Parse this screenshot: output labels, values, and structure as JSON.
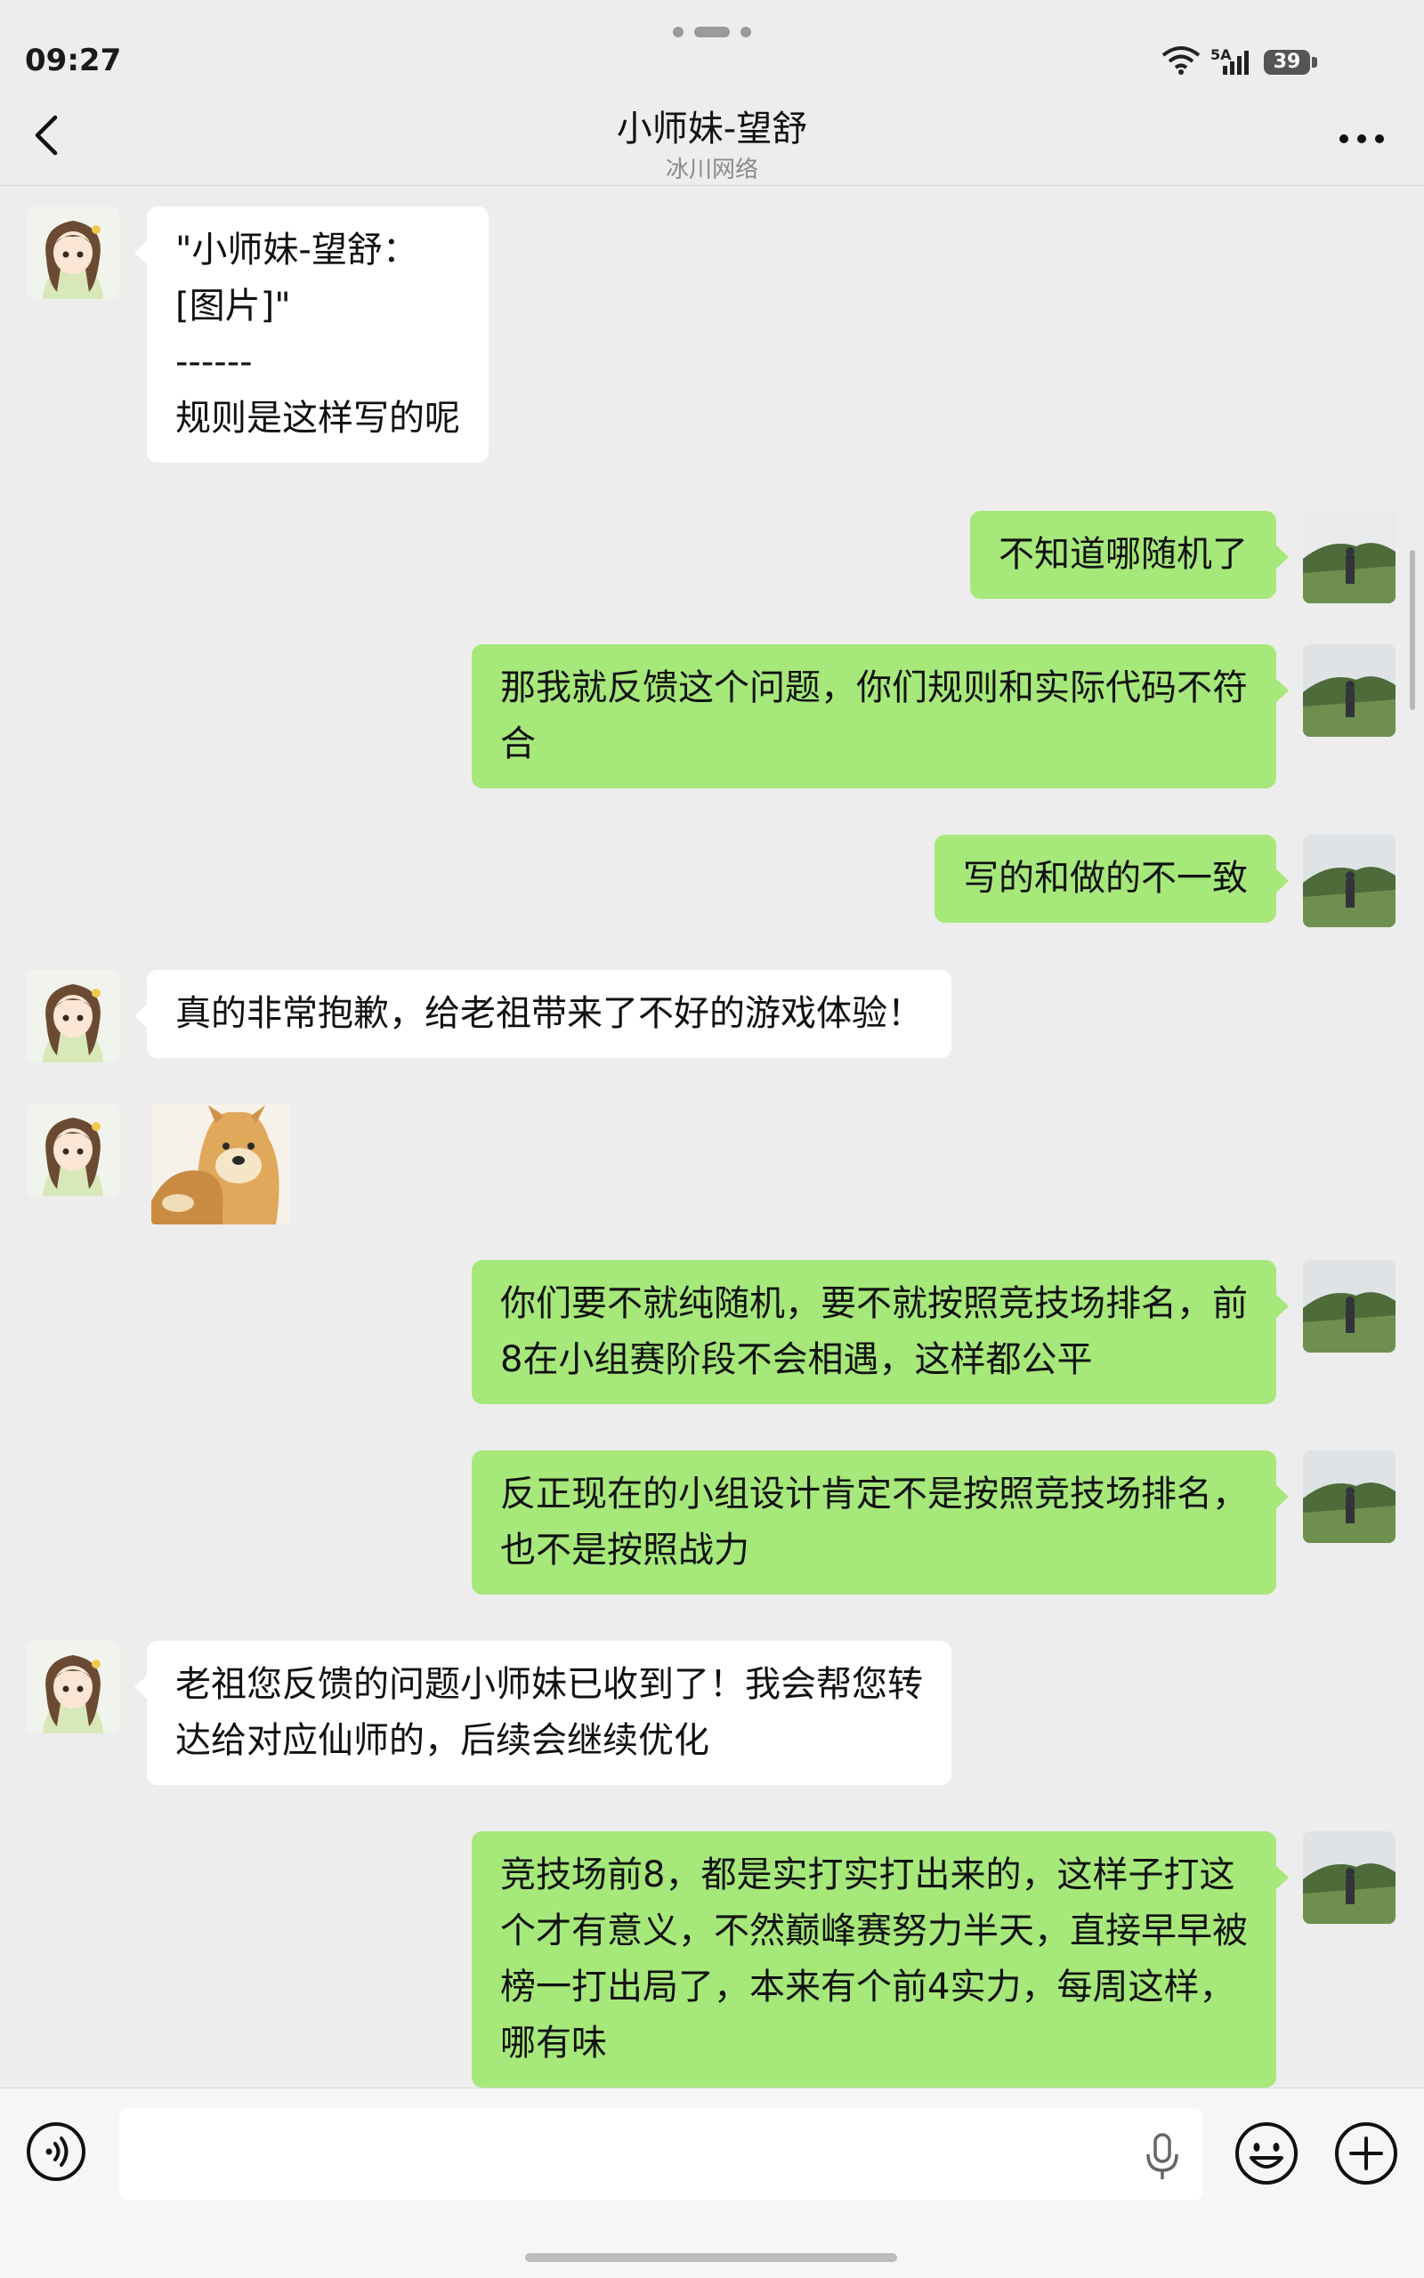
{
  "status_bar": {
    "time": "09:27",
    "network_label": "5A",
    "battery": "39"
  },
  "header": {
    "title": "小师妹-望舒",
    "subtitle": "冰川网络",
    "back_icon": "chevron-left-icon",
    "more_icon": "more-dots-icon"
  },
  "messages": [
    {
      "side": "left",
      "type": "text",
      "text": "\"小师妹-望舒：\n[图片]\"\n------\n规则是这样写的呢"
    },
    {
      "side": "right",
      "type": "text",
      "text": "不知道哪随机了"
    },
    {
      "side": "right",
      "type": "text",
      "text": "那我就反馈这个问题，你们规则和实际代码不符\n合"
    },
    {
      "side": "right",
      "type": "text",
      "text": "写的和做的不一致"
    },
    {
      "side": "left",
      "type": "text",
      "text": "真的非常抱歉，给老祖带来了不好的游戏体验！"
    },
    {
      "side": "left",
      "type": "sticker",
      "sticker": "doge-sticker"
    },
    {
      "side": "right",
      "type": "text",
      "text": "你们要不就纯随机，要不就按照竞技场排名，前\n8在小组赛阶段不会相遇，这样都公平"
    },
    {
      "side": "right",
      "type": "text",
      "text": "反正现在的小组设计肯定不是按照竞技场排名，\n也不是按照战力"
    },
    {
      "side": "left",
      "type": "text",
      "text": "老祖您反馈的问题小师妹已收到了！我会帮您转\n达给对应仙师的，后续会继续优化"
    },
    {
      "side": "right",
      "type": "text",
      "text": "竞技场前8，都是实打实打出来的，这样子打这\n个才有意义，不然巅峰赛努力半天，直接早早被\n榜一打出局了，本来有个前4实力，每周这样，\n哪有味"
    }
  ],
  "input_bar": {
    "placeholder": "",
    "value": "",
    "voice_icon": "voice-icon",
    "mic_icon": "microphone-icon",
    "emoji_icon": "emoji-icon",
    "plus_icon": "plus-icon"
  },
  "colors": {
    "background": "#ededed",
    "outgoing_bubble": "#a6e87a",
    "incoming_bubble": "#ffffff"
  }
}
